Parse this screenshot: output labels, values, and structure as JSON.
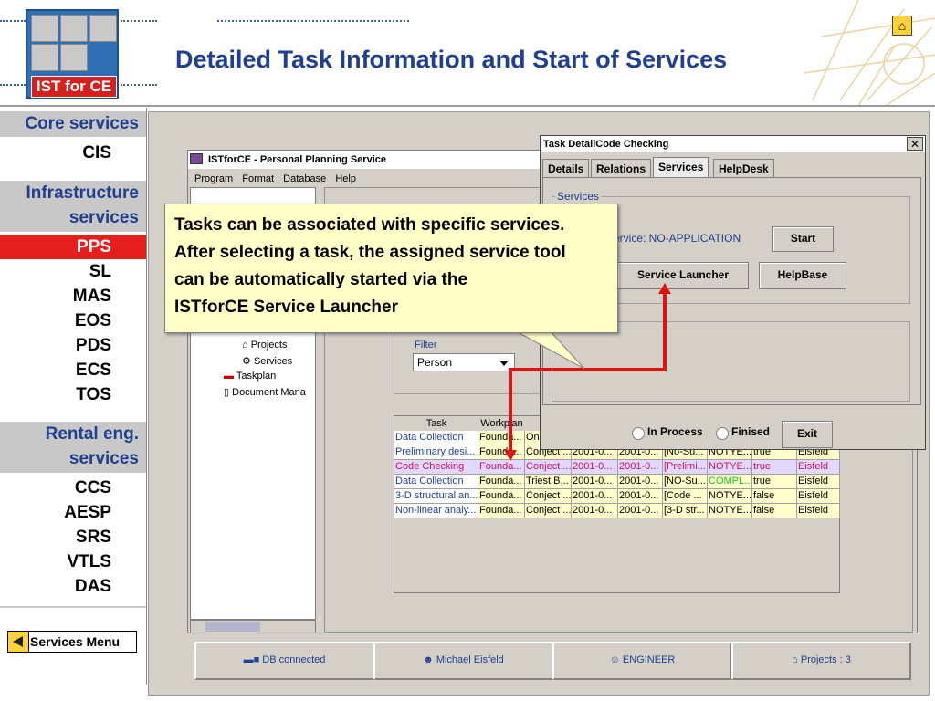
{
  "header": {
    "logo_text": "IST for CE",
    "title": "Detailed Task Information and Start of Services",
    "home_icon": "house-icon"
  },
  "sidebar": {
    "groups": [
      {
        "heading": [
          "Core services"
        ],
        "items": [
          "CIS"
        ]
      },
      {
        "heading": [
          "Infrastructure",
          "services"
        ],
        "items": [
          "PPS",
          "SL",
          "MAS",
          "EOS",
          "PDS",
          "ECS",
          "TOS"
        ]
      },
      {
        "heading": [
          "Rental eng.",
          "services"
        ],
        "items": [
          "CCS",
          "AESP",
          "SRS",
          "VTLS",
          "DAS"
        ]
      }
    ],
    "active_item": "PPS",
    "services_menu_label": "Services Menu"
  },
  "app": {
    "window_title": "ISTforCE - Personal Planning Service",
    "menu": [
      "Program",
      "Format",
      "Database",
      "Help"
    ],
    "tree_items": [
      "Projects",
      "Services",
      "Taskplan",
      "Document Mana"
    ],
    "filter_label": "Filter",
    "filter_value": "Person",
    "table": {
      "columns": [
        "Task",
        "Workplan",
        "P",
        "",
        "",
        "",
        "",
        "",
        ""
      ],
      "rows": [
        [
          "Data Collection",
          "Founda...",
          "On",
          "",
          "",
          "",
          "",
          "",
          ""
        ],
        [
          "Preliminary desi...",
          "Founda...",
          "Conject ...",
          "2001-0...",
          "2001-0...",
          "[No-Su...",
          "NOTYE...",
          "true",
          "Eisfeld"
        ],
        [
          "Code Checking",
          "Founda...",
          "Conject ...",
          "2001-0...",
          "2001-0...",
          "[Prelimi...",
          "NOTYE...",
          "true",
          "Eisfeld"
        ],
        [
          "Data Collection",
          "Founda...",
          "Triest B...",
          "2001-0...",
          "2001-0...",
          "[NO-Su...",
          "COMPL...",
          "true",
          "Eisfeld"
        ],
        [
          "3-D structural an...",
          "Founda...",
          "Conject ...",
          "2001-0...",
          "2001-0...",
          "[Code ...",
          "NOTYE...",
          "false",
          "Eisfeld"
        ],
        [
          "Non-linear analy...",
          "Founda...",
          "Conject ...",
          "2001-0...",
          "2001-0...",
          "[3-D str...",
          "NOTYE...",
          "false",
          "Eisfeld"
        ]
      ]
    },
    "status": [
      "DB connected",
      "Michael Eisfeld",
      "ENGINEER",
      "Projects : 3"
    ]
  },
  "dialog": {
    "title": "Task DetailCode Checking",
    "tabs": [
      "Details",
      "Relations",
      "Services",
      "HelpDesk"
    ],
    "active_tab": "Services",
    "group_label": "Services",
    "service_text": "ervice: NO-APPLICATION",
    "buttons": {
      "start": "Start",
      "launcher": "Service Launcher",
      "helpbase": "HelpBase",
      "exit": "Exit"
    },
    "radios": [
      "In Process",
      "Finised"
    ]
  },
  "callout": {
    "lines": [
      "Tasks can be associated with specific services.",
      "After selecting a task, the assigned service tool",
      "can be automatically started via the",
      "ISTforCE Service Launcher"
    ]
  },
  "colors": {
    "accent": "#1f3f8f",
    "active": "#e61e1e",
    "arrow": "#e01010",
    "callout_bg": "#ffffc8"
  }
}
